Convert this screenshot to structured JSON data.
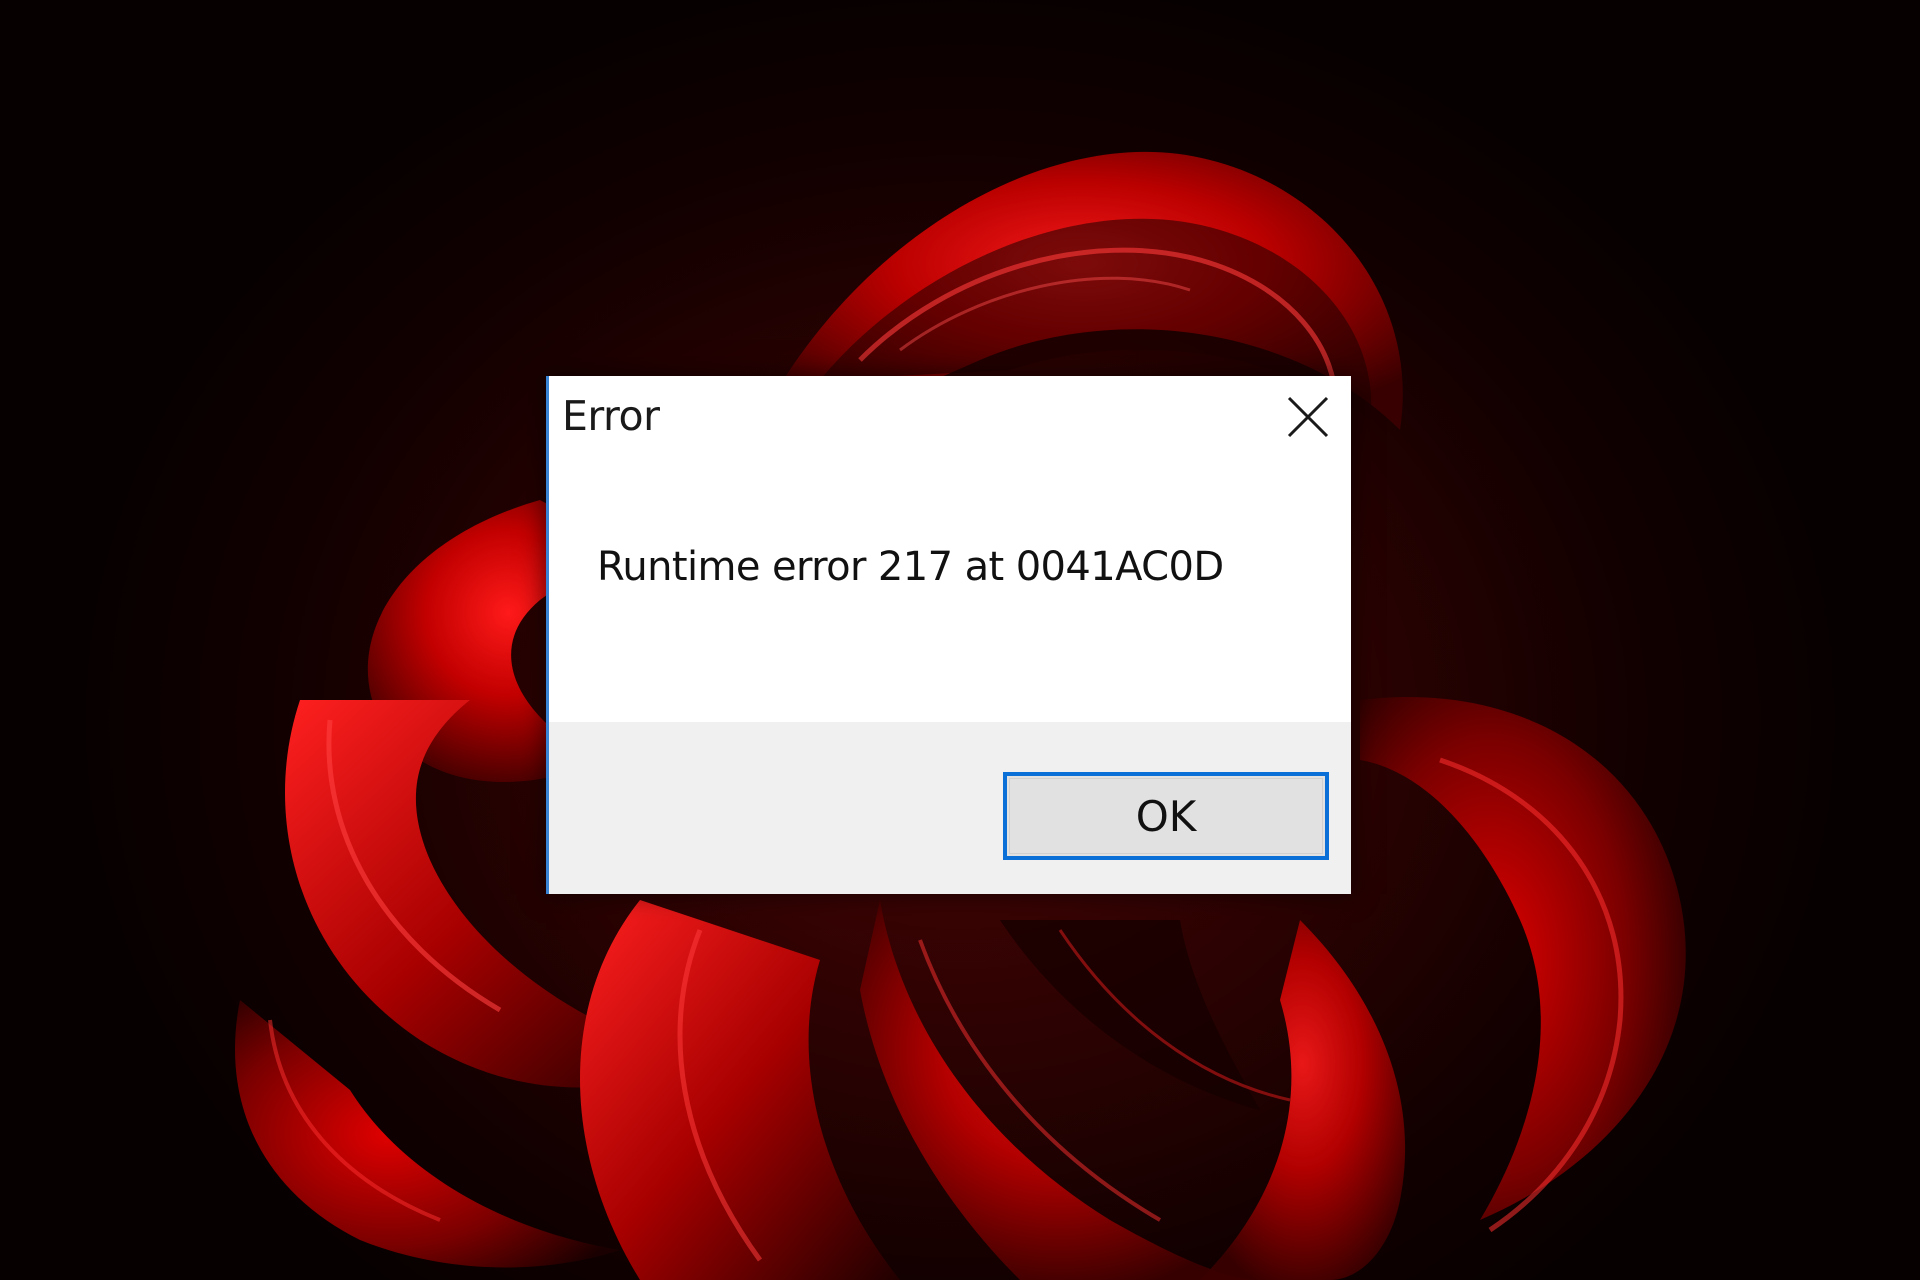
{
  "dialog": {
    "title": "Error",
    "message": "Runtime error 217 at 0041AC0D",
    "ok_label": "OK",
    "close_icon": "close-icon"
  },
  "colors": {
    "wallpaper_dark": "#0a0000",
    "wallpaper_red": "#c00000",
    "dialog_background": "#ffffff",
    "button_bar_background": "#f0f0f0",
    "accent_border": "#0a6fd6",
    "button_face": "#e1e1e1"
  }
}
